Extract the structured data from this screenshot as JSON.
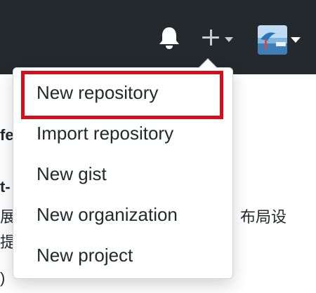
{
  "header": {
    "icons": [
      "bell-icon",
      "plus-icon",
      "chevron-down-icon",
      "avatar"
    ],
    "background_color": "#24292e"
  },
  "background_page": {
    "left_fragment_1": "fe",
    "left_fragment_2": "t-",
    "left_fragment_3": "展",
    "left_fragment_4": "提",
    "left_fragment_5": ")",
    "right_fragment": "布局设"
  },
  "dropdown": {
    "items": [
      {
        "label": "New repository"
      },
      {
        "label": "Import repository"
      },
      {
        "label": "New gist"
      },
      {
        "label": "New organization"
      },
      {
        "label": "New project"
      }
    ]
  },
  "annotation": {
    "highlight_color": "#d10f1d",
    "highlighted_item": "New repository"
  }
}
